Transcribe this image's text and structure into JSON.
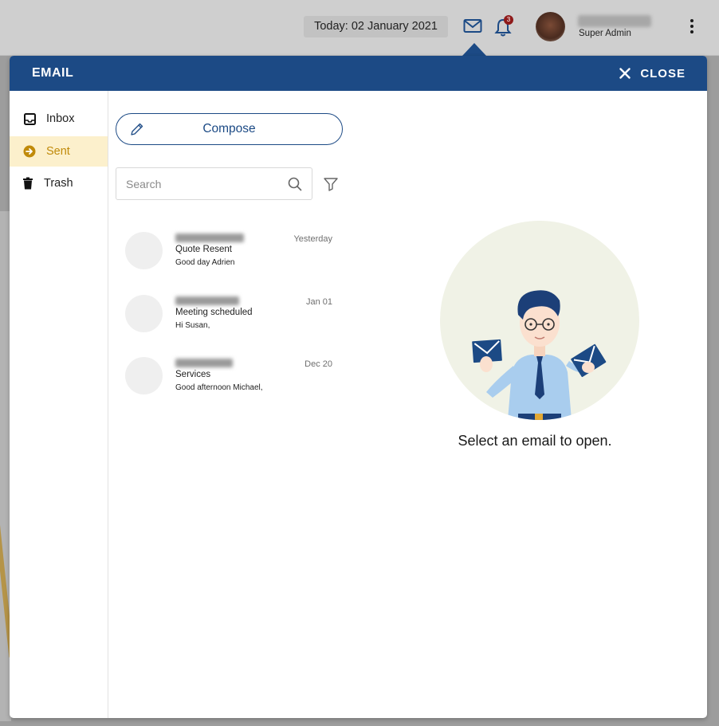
{
  "topbar": {
    "date_label": "Today: 02 January 2021",
    "notification_count": "3",
    "user_role": "Super Admin"
  },
  "modal": {
    "title": "EMAIL",
    "close_label": "CLOSE"
  },
  "nav": {
    "items": [
      {
        "label": "Inbox",
        "icon": "inbox-icon"
      },
      {
        "label": "Sent",
        "icon": "sent-arrow-icon",
        "active": true
      },
      {
        "label": "Trash",
        "icon": "trash-icon"
      }
    ]
  },
  "compose_label": "Compose",
  "search": {
    "placeholder": "Search"
  },
  "emails": [
    {
      "subject": "Quote Resent",
      "preview": "Good day Adrien",
      "date": "Yesterday"
    },
    {
      "subject": "Meeting scheduled",
      "preview": "Hi Susan,",
      "date": "Jan 01"
    },
    {
      "subject": "Services",
      "preview": "Good afternoon Michael,",
      "date": "Dec 20"
    }
  ],
  "empty_state": {
    "text": "Select an email to open."
  },
  "colors": {
    "primary": "#1c4a85",
    "active_bg": "#fcf0cc",
    "active_text": "#c08a0a",
    "illustration_bg": "#f0f2e6"
  }
}
